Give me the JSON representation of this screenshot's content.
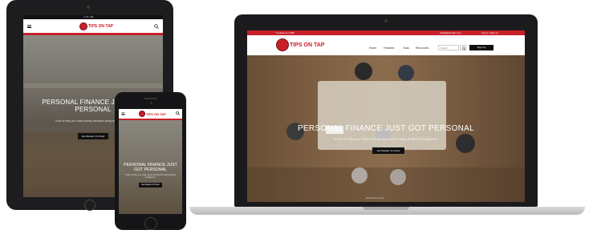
{
  "brand": {
    "logo_text": "TIPS ON TAP",
    "accent": "#c8202a",
    "nav_bg": "#ffffff",
    "button_bg": "#111111"
  },
  "tablet": {
    "status_time": "1:01 AM",
    "hero_title": "PERSONAL FINANCE JUST GOT PERSONAL",
    "hero_subtitle": "Tools to help you make money decisions using artificial intelligence",
    "cta": "Get Started, It's Free!"
  },
  "phone": {
    "hero_title": "PERSONAL FINANCE JUST GOT PERSONAL",
    "hero_subtitle": "Tools to help you make money decisions using artificial intelligence",
    "cta": "Get Started, It's Free!"
  },
  "laptop": {
    "topbar_phone": "Contact us 1-800",
    "topbar_email": "info@tipsontap.com",
    "topbar_login": "Log in / Sign up",
    "menu": [
      "Home",
      "Features",
      "Tools",
      "Resources"
    ],
    "search_placeholder": "Search",
    "signup": "Sign Up",
    "hero_title": "PERSONAL FINANCE JUST GOT PERSONAL",
    "hero_subtitle": "Tools to help you make money decisions using artificial intelligence",
    "cta": "Get Started, It's Free!",
    "footer_note": "Scroll to see more"
  }
}
